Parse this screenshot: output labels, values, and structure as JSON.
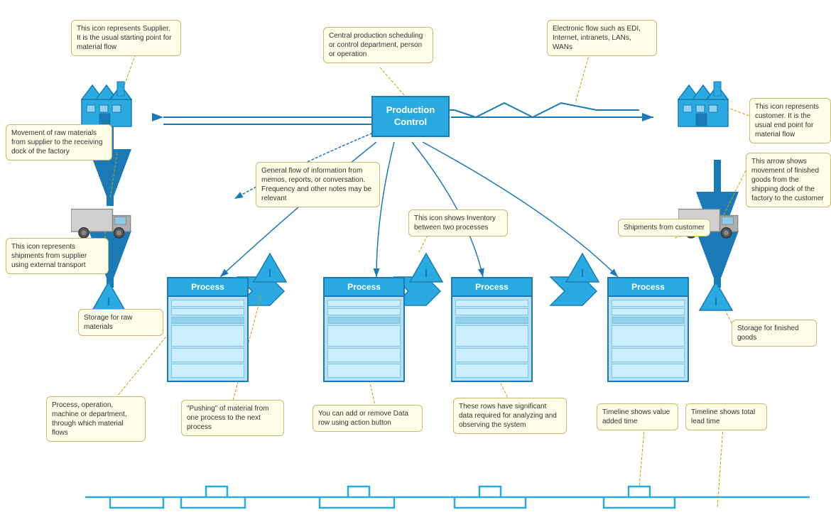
{
  "callouts": {
    "supplier_label": "This icon represents Supplier. It is the usual starting point for material flow",
    "prod_control_label": "Central production scheduling or control department, person or operation",
    "electronic_flow_label": "Electronic flow such as EDI, Internet, intranets, LANs, WANs",
    "customer_label": "This icon represents customer. It is the usual end point for material flow",
    "raw_movement_label": "Movement of raw materials from supplier to the receiving dock of the factory",
    "info_flow_label": "General flow of information from memos, reports, or conversation. Frequency and other notes may be relevant",
    "inventory_label": "This icon shows Inventory between two processes",
    "finished_movement_label": "This arrow shows movement of finished goods from the shipping dock of the factory to the customer",
    "supplier_transport_label": "This icon represents shipments from supplier using external transport",
    "shipments_customer_label": "Shipments from customer",
    "raw_storage_label": "Storage for raw materials",
    "finished_storage_label": "Storage for finished goods",
    "process_label": "Process, operation, machine or department, through which material flows",
    "push_label": "\"Pushing\" of material from one process to the next process",
    "data_row_label": "You can add or remove Data row using action button",
    "data_rows_label": "These rows have significant data required for analyzing and observing the system",
    "value_added_label": "Timeline shows value added time",
    "lead_time_label": "Timeline shows total lead time"
  },
  "process_title": "Process",
  "prod_control_title": "Production\nControl",
  "colors": {
    "blue": "#29abe2",
    "dark_blue": "#1a7ab5",
    "callout_bg": "#fffde7",
    "callout_border": "#c8b96e",
    "light_blue_bg": "#b8e0f5"
  }
}
